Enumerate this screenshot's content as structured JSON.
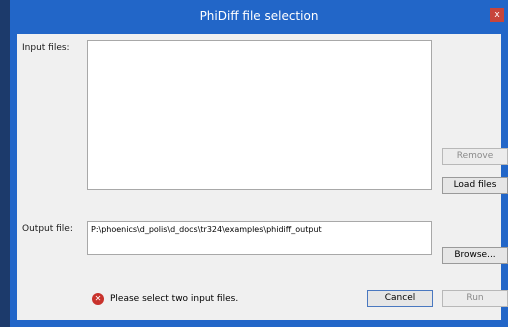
{
  "window": {
    "title": "PhiDiff file selection",
    "close_glyph": "x"
  },
  "input": {
    "label": "Input files:",
    "files": []
  },
  "output": {
    "label": "Output file:",
    "value": "P:\\phoenics\\d_polis\\d_docs\\tr324\\examples\\phidiff_output"
  },
  "buttons": {
    "remove": "Remove",
    "load_files": "Load files",
    "browse": "Browse...",
    "cancel": "Cancel",
    "run": "Run"
  },
  "status": {
    "icon": "error-icon",
    "icon_glyph": "✕",
    "message": "Please select two input files."
  },
  "colors": {
    "titlebar": "#2266c8",
    "client": "#f0f0f0",
    "error": "#c8322c"
  }
}
